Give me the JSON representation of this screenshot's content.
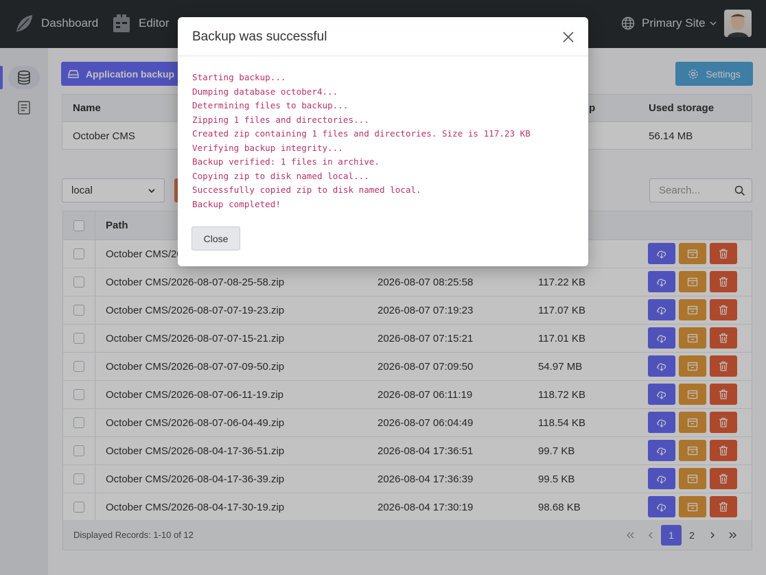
{
  "topnav": {
    "items": [
      {
        "label": "Dashboard",
        "icon": "october-leaf-icon"
      },
      {
        "label": "Editor",
        "icon": "editor-icon"
      }
    ],
    "site": "Primary Site"
  },
  "toolbar": {
    "app_backup_label": "Application backup",
    "settings_label": "Settings"
  },
  "apps_table": {
    "headers": {
      "name": "Name",
      "backup": "p",
      "used": "Used storage"
    },
    "row": {
      "name": "October CMS",
      "used": "56.14 MB"
    }
  },
  "disk": {
    "selected": "local"
  },
  "search": {
    "placeholder": "Search..."
  },
  "files_table": {
    "header_path": "Path",
    "rows": [
      {
        "path": "October CMS/20",
        "date": "",
        "size": ""
      },
      {
        "path": "October CMS/2026-08-07-08-25-58.zip",
        "date": "2026-08-07 08:25:58",
        "size": "117.22 KB"
      },
      {
        "path": "October CMS/2026-08-07-07-19-23.zip",
        "date": "2026-08-07 07:19:23",
        "size": "117.07 KB"
      },
      {
        "path": "October CMS/2026-08-07-07-15-21.zip",
        "date": "2026-08-07 07:15:21",
        "size": "117.01 KB"
      },
      {
        "path": "October CMS/2026-08-07-07-09-50.zip",
        "date": "2026-08-07 07:09:50",
        "size": "54.97 MB"
      },
      {
        "path": "October CMS/2026-08-07-06-11-19.zip",
        "date": "2026-08-07 06:11:19",
        "size": "118.72 KB"
      },
      {
        "path": "October CMS/2026-08-07-06-04-49.zip",
        "date": "2026-08-07 06:04:49",
        "size": "118.54 KB"
      },
      {
        "path": "October CMS/2026-08-04-17-36-51.zip",
        "date": "2026-08-04 17:36:51",
        "size": "99.7 KB"
      },
      {
        "path": "October CMS/2026-08-04-17-36-39.zip",
        "date": "2026-08-04 17:36:39",
        "size": "99.5 KB"
      },
      {
        "path": "October CMS/2026-08-04-17-30-19.zip",
        "date": "2026-08-04 17:30:19",
        "size": "98.68 KB"
      }
    ],
    "footer": "Displayed Records: 1-10 of 12",
    "pages": [
      "1",
      "2"
    ],
    "current_page": "1"
  },
  "modal": {
    "title": "Backup was successful",
    "log": "Starting backup...\nDumping database october4...\nDetermining files to backup...\nZipping 1 files and directories...\nCreated zip containing 1 files and directories. Size is 117.23 KB\nVerifying backup integrity...\nBackup verified: 1 files in archive.\nCopying zip to disk named local...\nSuccessfully copied zip to disk named local.\nBackup completed!",
    "close_label": "Close"
  },
  "colors": {
    "primary": "#6a6cf7",
    "warning": "#e39a3c",
    "danger": "#e2613a",
    "info": "#52a5d8",
    "log_text": "#b8326a"
  }
}
